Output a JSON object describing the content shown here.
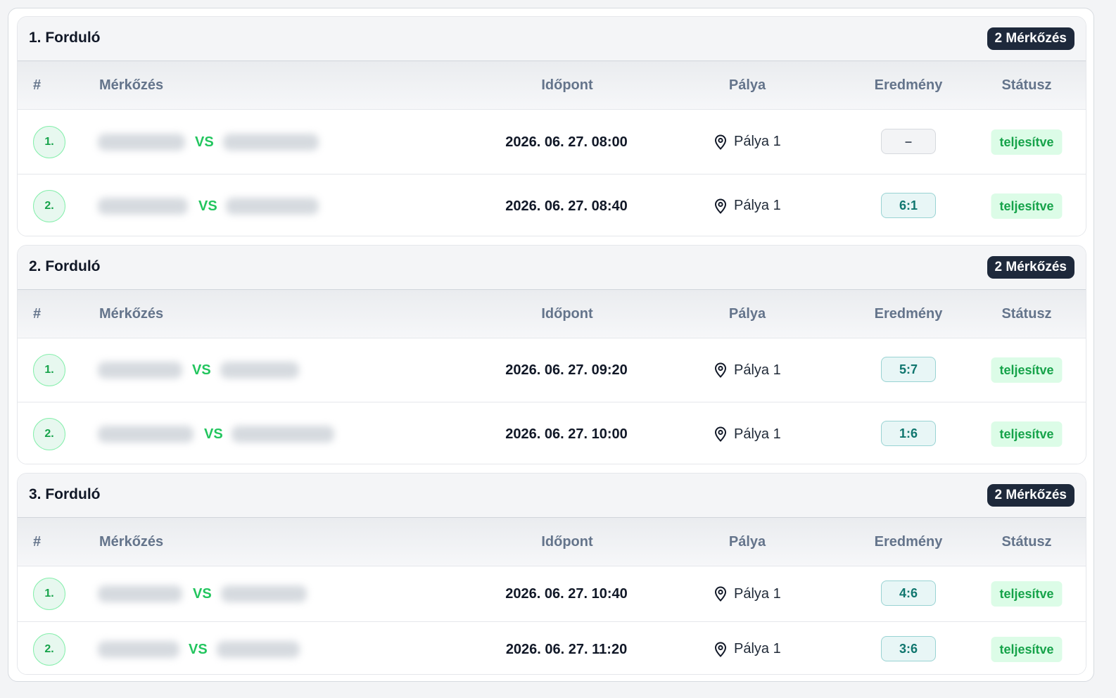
{
  "headers": {
    "num": "#",
    "match": "Mérkőzés",
    "time": "Időpont",
    "venue": "Pálya",
    "result": "Eredmény",
    "status": "Státusz"
  },
  "vs_label": "VS",
  "rounds": [
    {
      "title": "1. Forduló",
      "badge": "2 Mérkőzés",
      "matches": [
        {
          "num": "1.",
          "time": "2026. 06. 27. 08:00",
          "venue": "Pálya 1",
          "result": "–",
          "status": "teljesítve"
        },
        {
          "num": "2.",
          "time": "2026. 06. 27. 08:40",
          "venue": "Pálya 1",
          "result": "6:1",
          "status": "teljesítve"
        }
      ]
    },
    {
      "title": "2. Forduló",
      "badge": "2 Mérkőzés",
      "matches": [
        {
          "num": "1.",
          "time": "2026. 06. 27. 09:20",
          "venue": "Pálya 1",
          "result": "5:7",
          "status": "teljesítve"
        },
        {
          "num": "2.",
          "time": "2026. 06. 27. 10:00",
          "venue": "Pálya 1",
          "result": "1:6",
          "status": "teljesítve"
        }
      ]
    },
    {
      "title": "3. Forduló",
      "badge": "2 Mérkőzés",
      "matches": [
        {
          "num": "1.",
          "time": "2026. 06. 27. 10:40",
          "venue": "Pálya 1",
          "result": "4:6",
          "status": "teljesítve"
        },
        {
          "num": "2.",
          "time": "2026. 06. 27. 11:20",
          "venue": "Pálya 1",
          "result": "3:6",
          "status": "teljesítve"
        }
      ]
    }
  ],
  "colors": {
    "accent_green": "#22c55e",
    "status_bg": "#dcfce7",
    "score_teal": "#0f766e",
    "badge_dark": "#1e293b"
  },
  "icons": {
    "venue": "map-pin-icon"
  }
}
